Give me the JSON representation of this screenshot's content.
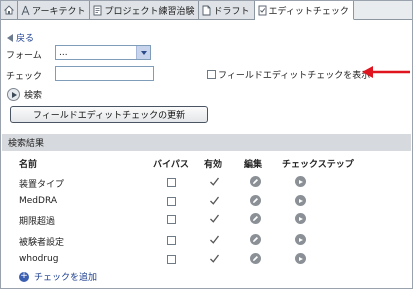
{
  "tabs": [
    {
      "label": "",
      "icon": "home-icon"
    },
    {
      "label": "アーキテクト",
      "icon": "architect-icon"
    },
    {
      "label": "プロジェクト練習治験",
      "icon": "project-icon"
    },
    {
      "label": "ドラフト",
      "icon": "draft-icon"
    },
    {
      "label": "エディットチェック",
      "icon": "editcheck-icon",
      "active": true
    }
  ],
  "back_label": "戻る",
  "form": {
    "label": "フォーム",
    "value": "..."
  },
  "check": {
    "label": "チェック",
    "value": ""
  },
  "show_field_edit_checks": {
    "label": "フィールドエディットチェックを表示",
    "checked": false
  },
  "search": {
    "label": "検索"
  },
  "update_button": "フィールドエディットチェックの更新",
  "results": {
    "title": "検索結果",
    "columns": {
      "name": "名前",
      "bypass": "バイパス",
      "active": "有効",
      "edit": "編集",
      "check_steps": "チェックステップ"
    },
    "rows": [
      {
        "name": "装置タイプ",
        "bypass": false,
        "active": true
      },
      {
        "name": "MedDRA",
        "bypass": false,
        "active": true
      },
      {
        "name": "期限超過",
        "bypass": false,
        "active": true
      },
      {
        "name": "被験者設定",
        "bypass": false,
        "active": true
      },
      {
        "name": "whodrug",
        "bypass": false,
        "active": true
      }
    ]
  },
  "add_check_label": "チェックを追加",
  "colors": {
    "annotation_arrow": "#e0141e",
    "link": "#1a3d8f"
  }
}
